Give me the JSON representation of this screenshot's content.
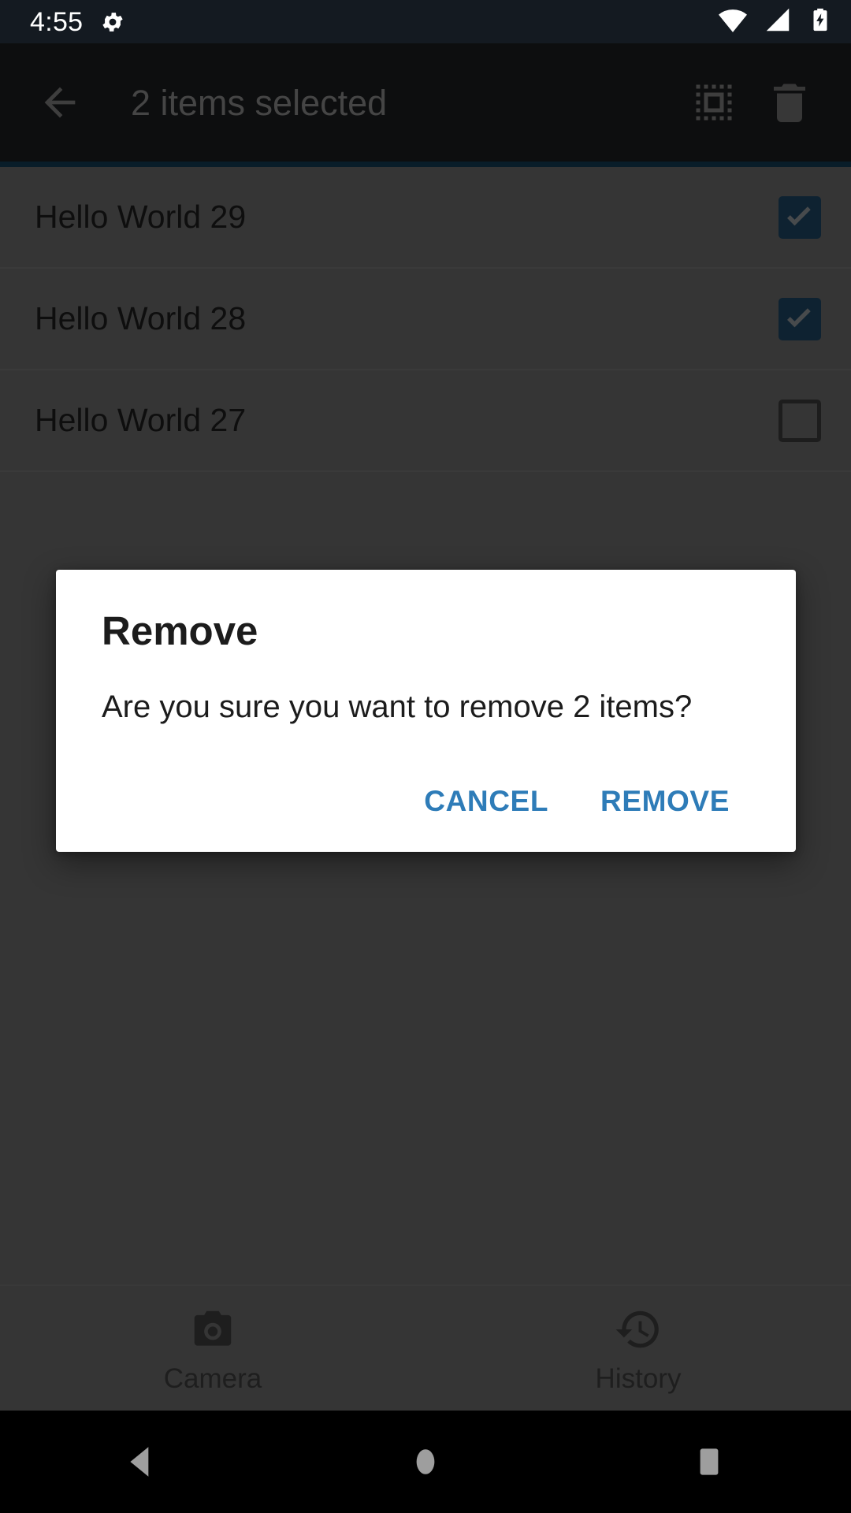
{
  "status_bar": {
    "clock": "4:55",
    "left_icons": [
      "gear-icon"
    ],
    "right_icons": [
      "wifi-icon",
      "cellular-signal-icon",
      "battery-charging-icon"
    ],
    "background_color": "#141a21",
    "foreground_color": "#ffffff"
  },
  "action_bar": {
    "back_icon": "arrow-left-icon",
    "title": "2 items selected",
    "actions": [
      {
        "icon": "select-all-icon",
        "label": "Select all"
      },
      {
        "icon": "delete-trash-icon",
        "label": "Delete"
      }
    ],
    "background_color": "#1b1d1f",
    "title_color": "#8b8b8b",
    "underline_color": "#123a52"
  },
  "list": {
    "items": [
      {
        "label": "Hello World 29",
        "checked": true
      },
      {
        "label": "Hello World 28",
        "checked": true
      },
      {
        "label": "Hello World 27",
        "checked": false
      }
    ],
    "checkbox_checked_color": "#1d4462",
    "checkbox_unchecked_color": "#3b3b3b",
    "row_text_color": "#1c1c1c"
  },
  "bottom_nav": {
    "tabs": [
      {
        "icon": "camera-icon",
        "label": "Camera"
      },
      {
        "icon": "history-clock-icon",
        "label": "History"
      }
    ],
    "label_color": "#3d3d3d"
  },
  "dialog": {
    "title": "Remove",
    "message": "Are you sure you want to remove 2 items?",
    "cancel_label": "CANCEL",
    "confirm_label": "REMOVE",
    "button_color": "#2e7cb8",
    "background_color": "#ffffff",
    "text_color": "#1c1c1c"
  },
  "system_nav": {
    "buttons": [
      {
        "icon": "nav-back-triangle-icon",
        "label": "Back"
      },
      {
        "icon": "nav-home-circle-icon",
        "label": "Home"
      },
      {
        "icon": "nav-recents-square-icon",
        "label": "Recents"
      }
    ],
    "background_color": "#000000",
    "icon_color": "#9e9e9e"
  },
  "scrim": {
    "opacity": "0.50",
    "color": "#000000"
  }
}
